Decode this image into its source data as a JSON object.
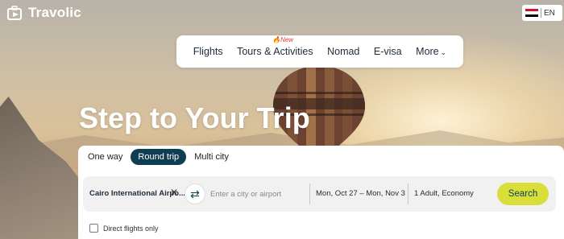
{
  "brand": {
    "name": "Travolic"
  },
  "language": {
    "code": "EN",
    "flag_colors": [
      "#ce1126",
      "#ffffff",
      "#000000"
    ]
  },
  "nav": {
    "items": [
      {
        "label": "Flights"
      },
      {
        "label": "Tours & Activities",
        "badge": "New"
      },
      {
        "label": "Nomad"
      },
      {
        "label": "E-visa"
      },
      {
        "label": "More",
        "has_dropdown": true
      }
    ]
  },
  "hero": {
    "title": "Step to Your Trip"
  },
  "search": {
    "trip_types": [
      {
        "label": "One way",
        "active": false
      },
      {
        "label": "Round trip",
        "active": true
      },
      {
        "label": "Multi city",
        "active": false
      }
    ],
    "origin_value": "Cairo International Airpo...",
    "destination_placeholder": "Enter a city or airport",
    "dates_value": "Mon, Oct 27 – Mon, Nov 3",
    "passengers_value": "1 Adult, Economy",
    "search_label": "Search",
    "direct_flights_label": "Direct flights only",
    "direct_flights_checked": false
  },
  "colors": {
    "accent": "#d9df3a",
    "primary": "#0f3d52",
    "new_badge": "#e33b3b"
  }
}
